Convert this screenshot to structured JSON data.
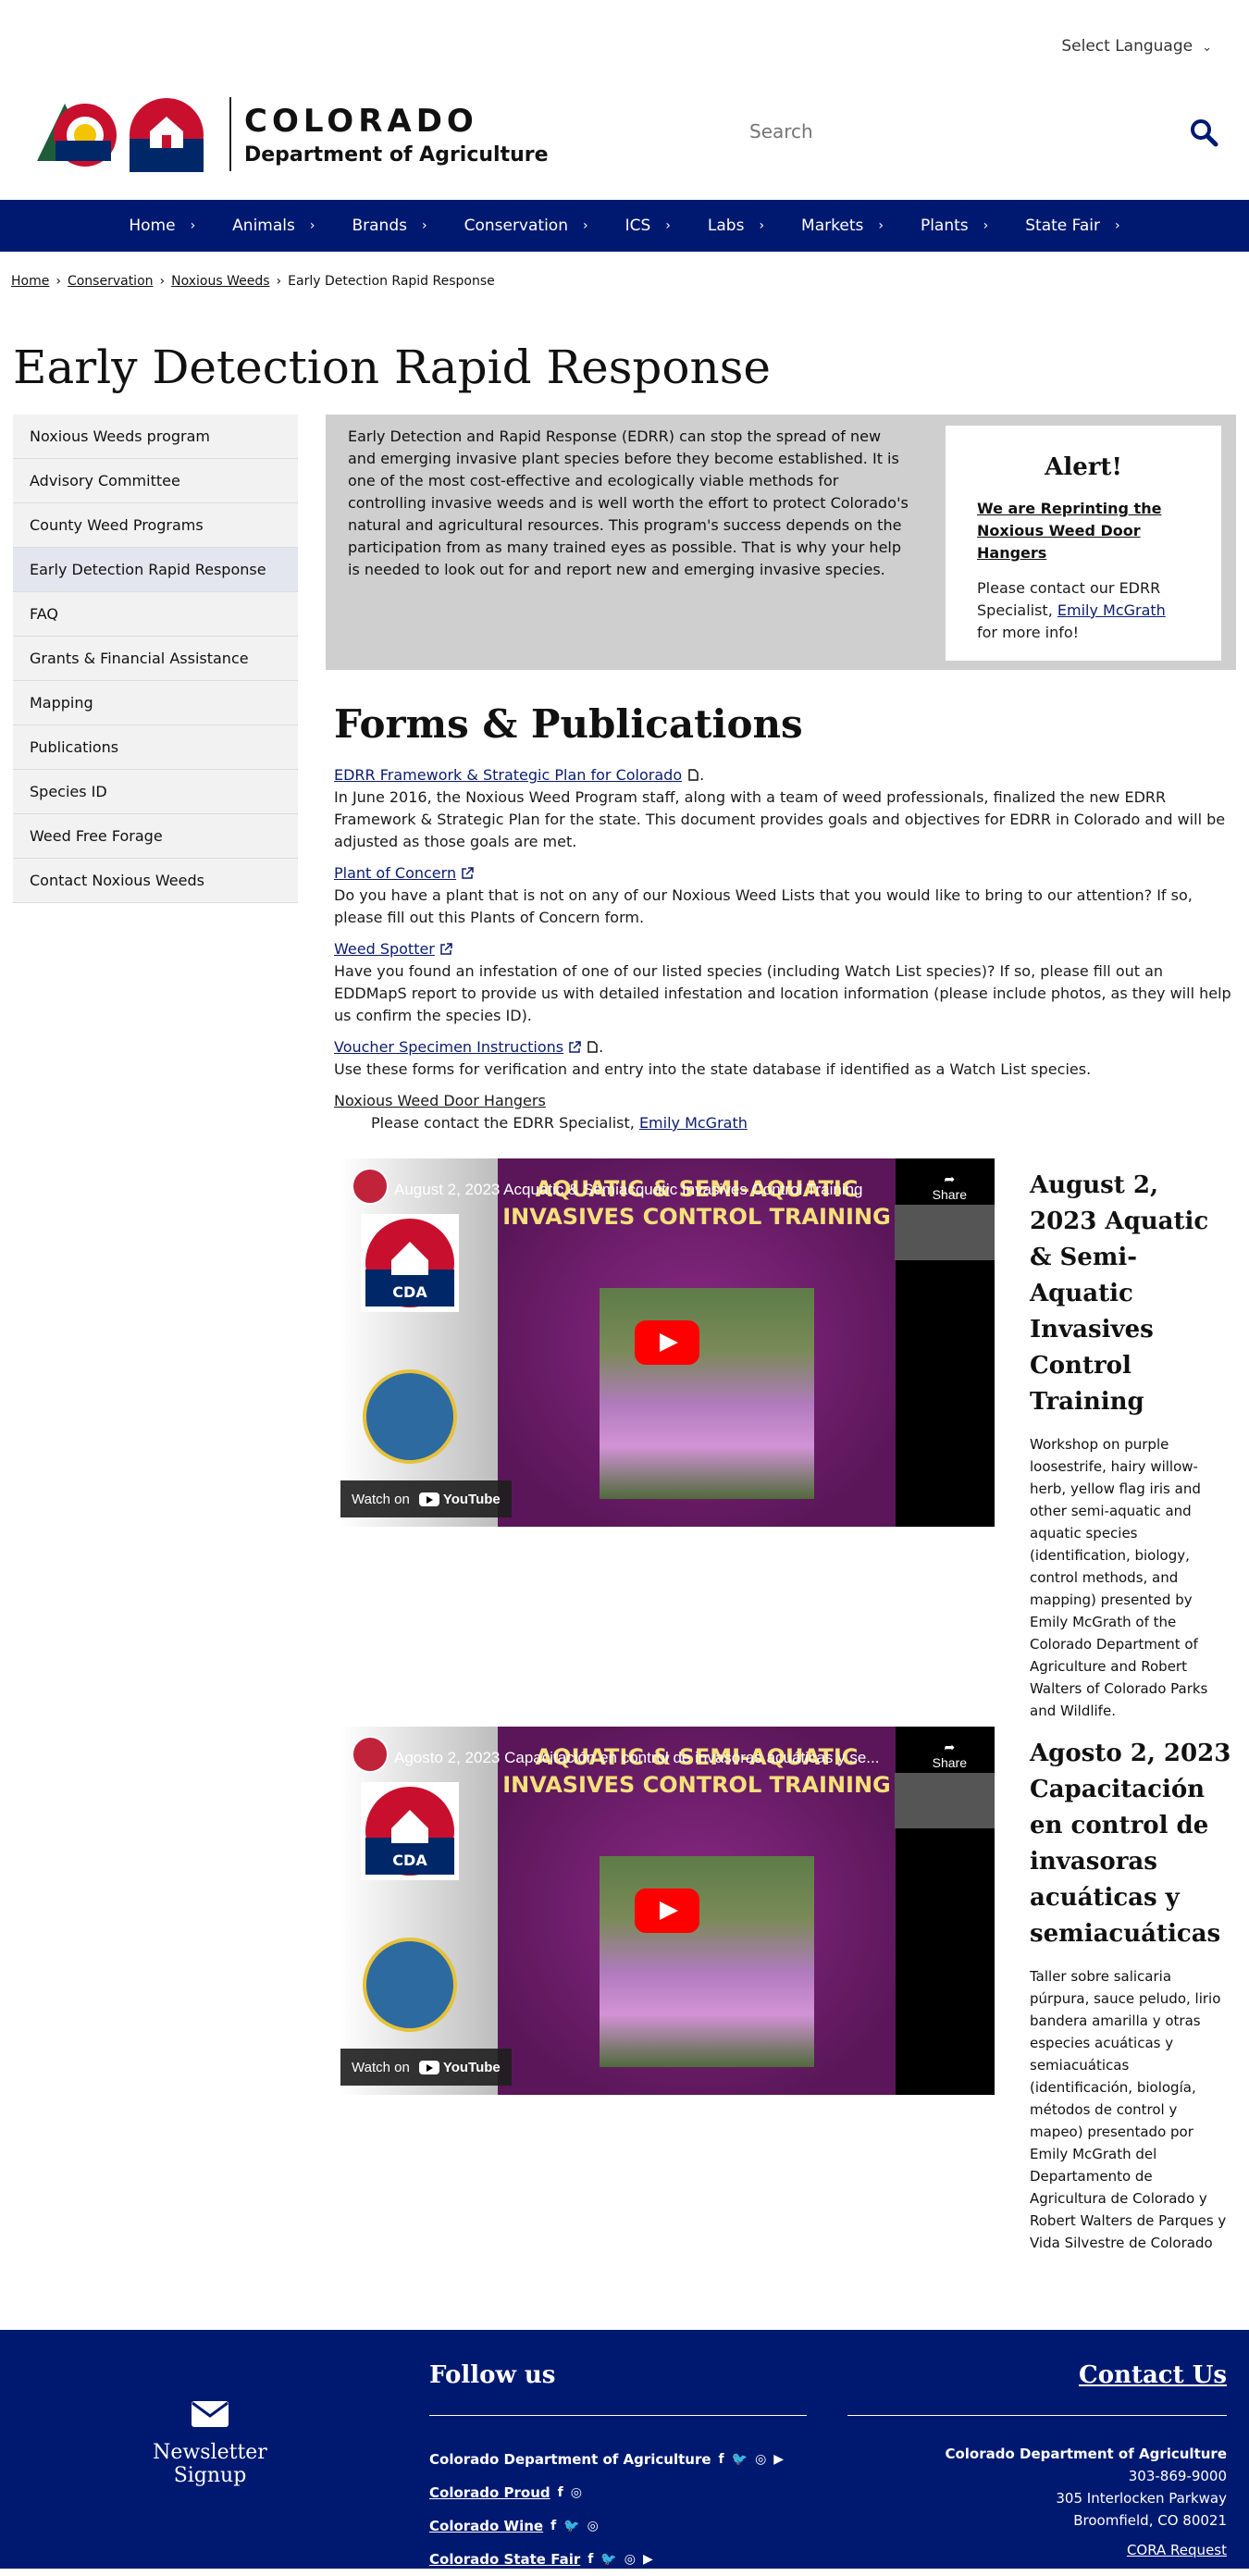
{
  "header": {
    "language_label": "Select Language",
    "logo_line1": "COLORADO",
    "logo_line2": "Department of Agriculture",
    "logo_badge": "CDA",
    "search_placeholder": "Search"
  },
  "nav": {
    "items": [
      "Home",
      "Animals",
      "Brands",
      "Conservation",
      "ICS",
      "Labs",
      "Markets",
      "Plants",
      "State Fair"
    ]
  },
  "breadcrumb": {
    "items": [
      "Home",
      "Conservation",
      "Noxious Weeds"
    ],
    "current": "Early Detection Rapid Response"
  },
  "page_title": "Early Detection Rapid Response",
  "sidebar": {
    "items": [
      "Noxious Weeds program",
      "Advisory Committee",
      "County Weed Programs",
      "Early Detection Rapid Response",
      "FAQ",
      "Grants & Financial Assistance",
      "Mapping",
      "Publications",
      "Species ID",
      "Weed Free Forage",
      "Contact Noxious Weeds"
    ],
    "active_index": 3
  },
  "intro": {
    "text": "Early Detection and Rapid Response (EDRR) can stop the spread of new and emerging invasive plant species before they become established. It is one of the most cost-effective and ecologically viable methods for controlling invasive weeds and is well worth the effort to protect Colorado's natural and agricultural resources. This program's success depends on the participation from as many trained eyes as possible. That is why your help is needed to look out for and report new and emerging invasive species."
  },
  "alert": {
    "heading": "Alert!",
    "link_text": "We are Reprinting  the Noxious Weed Door Hangers",
    "body_before": "Please contact our EDRR Specialist, ",
    "body_link": "Emily McGrath",
    "body_after": " for more info!"
  },
  "forms": {
    "heading": "Forms & Publications",
    "items": [
      {
        "link": "EDRR Framework & Strategic Plan for Colorado",
        "suffix": ".",
        "desc": "In June 2016, the Noxious Weed Program staff, along with a team of weed professionals, finalized the new EDRR Framework & Strategic Plan for the state. This document provides goals and objectives for EDRR in Colorado and will be adjusted as those goals are met."
      },
      {
        "link": "Plant of Concern",
        "desc": "Do you have a plant that is not on any of our Noxious Weed Lists that you would like to bring to our attention? If so, please fill out this Plants of Concern form."
      },
      {
        "link": "Weed Spotter",
        "desc": "Have you found an infestation of one of our listed species (including Watch List species)? If so, please fill out an EDDMapS report to provide us with detailed infestation and location information (please include photos, as they will help us confirm the species ID)."
      },
      {
        "link": "Voucher Specimen Instructions",
        "suffix": ".",
        "desc": "Use these forms for verification and entry into the state database if identified as a Watch List species."
      }
    ],
    "door_hangers": "Noxious Weed Door Hangers ",
    "door_hangers_before": "Please contact the EDRR Specialist, ",
    "door_hangers_link": "Emily McGrath"
  },
  "videos": [
    {
      "player_title": "August 2, 2023 Acquatic & Semiacquatic Invasives Control Training",
      "slide_title": "AQUATIC & SEMI-AQUATIC INVASIVES CONTROL TRAINING",
      "share": "Share",
      "watch_on": "Watch on",
      "youtube": "YouTube",
      "heading": "August 2, 2023 Aquatic & Semi-Aquatic Invasives Control Training",
      "desc": "Workshop on purple loosestrife, hairy willow-herb, yellow flag iris and other semi-aquatic and aquatic species (identification, biology, control methods, and mapping) presented by Emily McGrath of the Colorado Department of Agriculture and Robert Walters of Colorado Parks and Wildlife."
    },
    {
      "player_title": "Agosto 2, 2023 Capacitación en control de invasoras acuáticas y se...",
      "slide_title": "AQUATIC & SEMI-AQUATIC INVASIVES CONTROL TRAINING",
      "share": "Share",
      "watch_on": "Watch on",
      "youtube": "YouTube",
      "heading": "Agosto 2, 2023 Capacitación en control de invasoras acuáticas y semiacuáticas",
      "desc": "Taller sobre salicaria púrpura, sauce peludo, lirio bandera amarilla y otras especies acuáticas y semiacuáticas (identificación, biología, métodos de control y mapeo) presentado por Emily McGrath del Departamento de Agricultura de Colorado y Robert Walters de Parques y Vida Silvestre de Colorado"
    }
  ],
  "footer": {
    "newsletter": "Newsletter Signup",
    "follow_heading": "Follow us",
    "follow_links": [
      {
        "label": "Colorado Department of Agriculture",
        "underline": false,
        "icons": [
          "facebook-icon",
          "twitter-icon",
          "instagram-icon",
          "youtube-icon"
        ]
      },
      {
        "label": "Colorado Proud",
        "underline": true,
        "icons": [
          "facebook-icon",
          "instagram-icon"
        ]
      },
      {
        "label": "Colorado Wine",
        "underline": true,
        "icons": [
          "facebook-icon",
          "twitter-icon",
          "instagram-icon"
        ]
      },
      {
        "label": "Colorado State Fair",
        "underline": true,
        "icons": [
          "facebook-icon",
          "twitter-icon",
          "instagram-icon",
          "youtube-icon"
        ]
      }
    ],
    "contact_heading": "Contact Us",
    "contact_org": "Colorado Department of Agriculture",
    "contact_phone": "303-869-9000",
    "contact_address1": "305 Interlocken Parkway",
    "contact_address2": "Broomfield, CO 80021",
    "contact_link": "CORA Request"
  },
  "colors": {
    "nav_bg": "#001970",
    "link": "#0b1c6d",
    "intro_bg": "#cfcfcf",
    "sidebar_bg": "#f2f2f2",
    "active_bg": "#e3e6ee"
  }
}
